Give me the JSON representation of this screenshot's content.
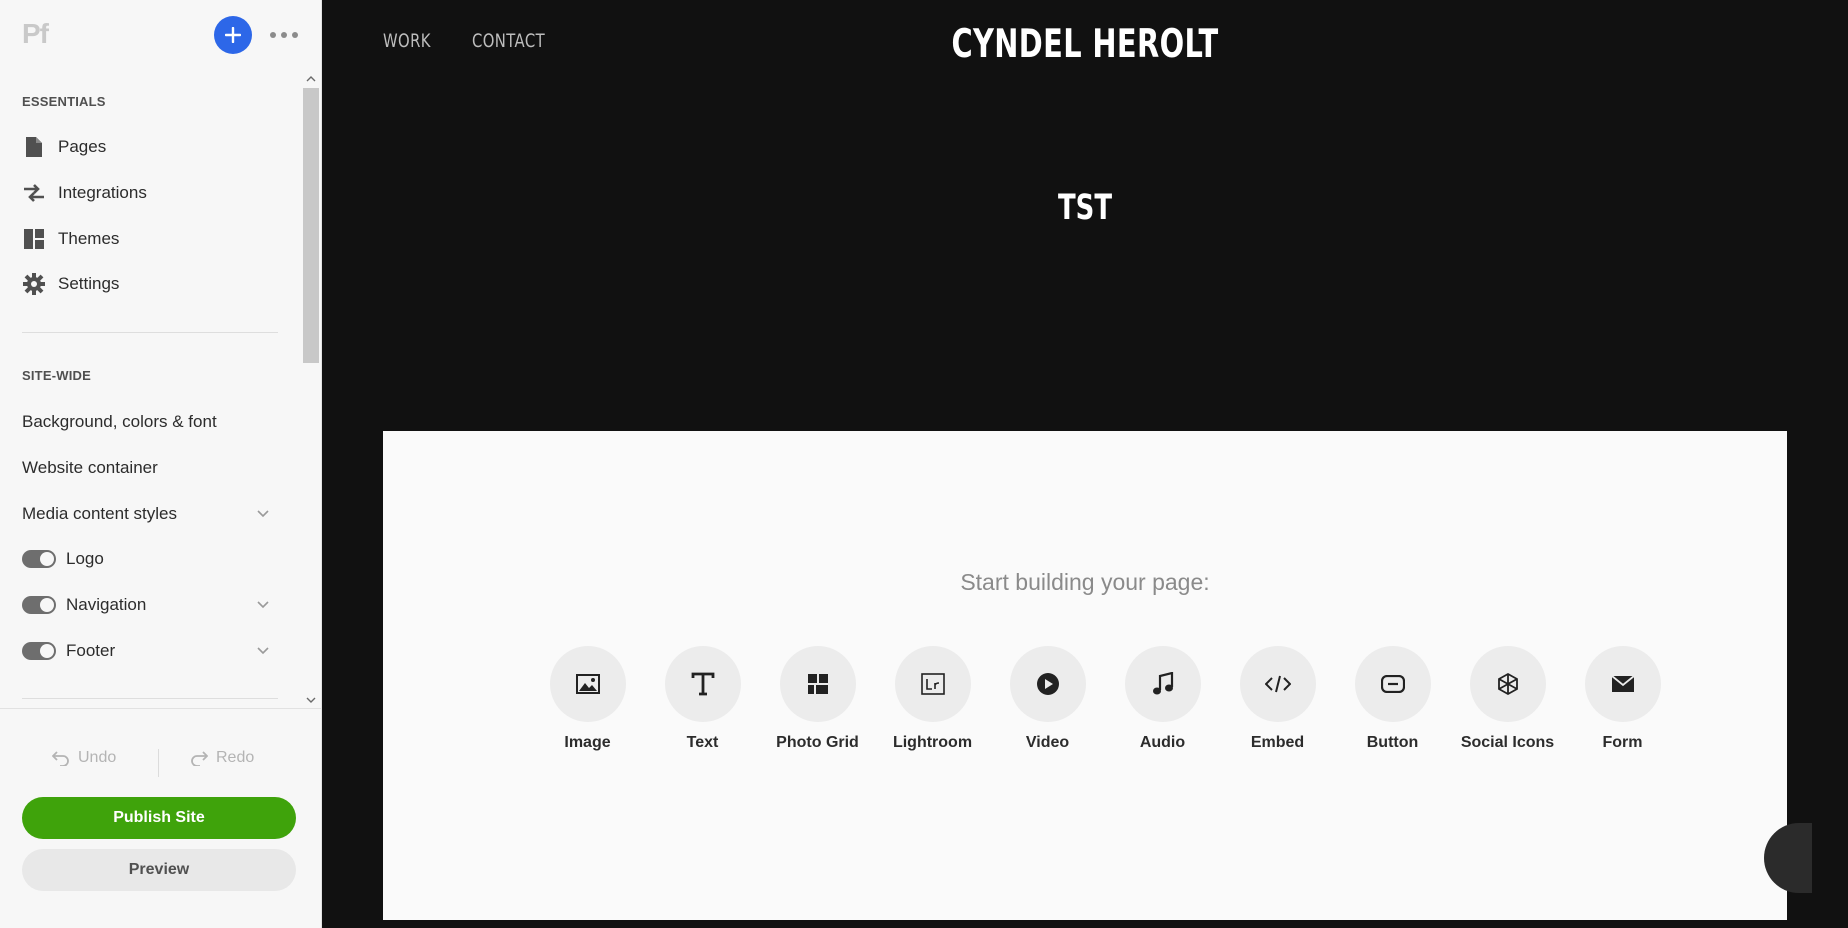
{
  "sidebar": {
    "logo": "Pf",
    "essentials_label": "ESSENTIALS",
    "essentials": [
      {
        "label": "Pages",
        "icon": "page-icon"
      },
      {
        "label": "Integrations",
        "icon": "integrations-icon"
      },
      {
        "label": "Themes",
        "icon": "themes-icon"
      },
      {
        "label": "Settings",
        "icon": "gear-icon"
      }
    ],
    "sitewide_label": "SITE-WIDE",
    "sitewide": [
      {
        "label": "Background, colors & font"
      },
      {
        "label": "Website container"
      },
      {
        "label": "Media content styles",
        "expandable": true
      },
      {
        "label": "Logo",
        "toggle": true
      },
      {
        "label": "Navigation",
        "toggle": true,
        "expandable": true
      },
      {
        "label": "Footer",
        "toggle": true,
        "expandable": true
      }
    ],
    "undo_label": "Undo",
    "redo_label": "Redo",
    "publish_label": "Publish Site",
    "preview_label": "Preview"
  },
  "site": {
    "nav": [
      "WORK",
      "CONTACT"
    ],
    "title": "CYNDEL HEROLT",
    "page_heading": "TST",
    "start_prompt": "Start building your page:",
    "tools": [
      {
        "label": "Image",
        "icon": "image-icon"
      },
      {
        "label": "Text",
        "icon": "text-icon"
      },
      {
        "label": "Photo Grid",
        "icon": "photo-grid-icon"
      },
      {
        "label": "Lightroom",
        "icon": "lightroom-icon"
      },
      {
        "label": "Video",
        "icon": "video-icon"
      },
      {
        "label": "Audio",
        "icon": "audio-icon"
      },
      {
        "label": "Embed",
        "icon": "embed-icon"
      },
      {
        "label": "Button",
        "icon": "button-icon"
      },
      {
        "label": "Social Icons",
        "icon": "social-icons-icon"
      },
      {
        "label": "Form",
        "icon": "form-icon"
      }
    ]
  },
  "colors": {
    "accent_blue": "#2d67e8",
    "publish_green": "#3fa30b",
    "canvas_bg": "#111111",
    "content_bg": "#fafafa"
  }
}
